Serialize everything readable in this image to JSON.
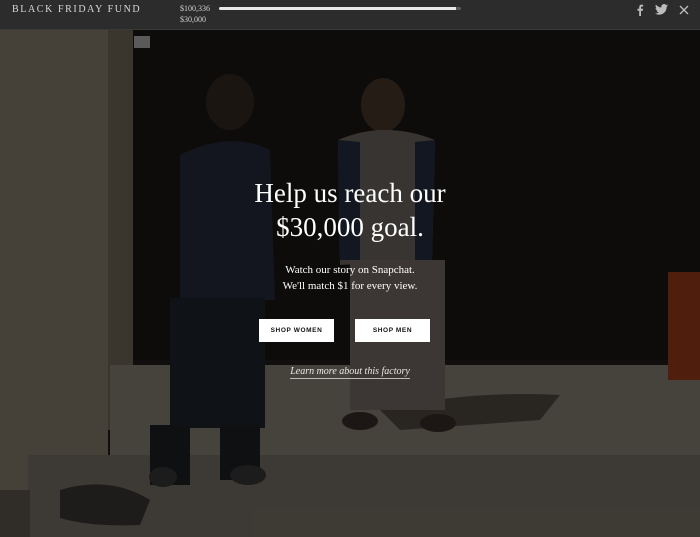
{
  "header": {
    "brand": "BLACK FRIDAY FUND",
    "raised": "$100,336",
    "goal": "$30,000",
    "progress_fraction": 0.98
  },
  "social_icons": [
    "facebook-icon",
    "twitter-icon",
    "close-icon"
  ],
  "hero": {
    "headline_line1": "Help us reach our",
    "headline_line2": "$30,000 goal.",
    "subtext_line1": "Watch our story on Snapchat.",
    "subtext_line2": "We'll match $1 for every view.",
    "shop_women": "SHOP WOMEN",
    "shop_men": "SHOP MEN",
    "learn_more": "Learn more about this factory"
  },
  "colors": {
    "topbar": "#2c2c2c",
    "overlay": "rgba(0,0,0,0.45)",
    "button_bg": "#ffffff"
  }
}
